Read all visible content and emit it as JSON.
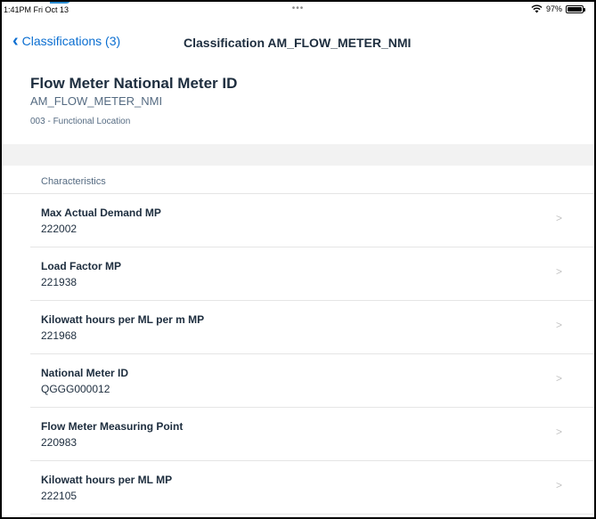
{
  "status_bar": {
    "time": "1:41PM  Fri Oct 13",
    "dots": "•••",
    "battery": "97%"
  },
  "nav": {
    "back_label": "Classifications (3)",
    "title": "Classification AM_FLOW_METER_NMI"
  },
  "header": {
    "title": "Flow Meter National Meter ID",
    "subtitle": "AM_FLOW_METER_NMI",
    "detail": "003 - Functional Location"
  },
  "characteristics": {
    "section_label": "Characteristics",
    "items": [
      {
        "label": "Max Actual Demand MP",
        "value": "222002"
      },
      {
        "label": "Load Factor MP",
        "value": "221938"
      },
      {
        "label": "Kilowatt hours per ML per m MP",
        "value": "221968"
      },
      {
        "label": "National Meter ID",
        "value": "QGGG000012"
      },
      {
        "label": "Flow Meter Measuring Point",
        "value": "220983"
      },
      {
        "label": "Kilowatt hours per ML MP",
        "value": "222105"
      }
    ]
  },
  "colors": {
    "accent": "#0a6ed1",
    "text": "#1d2d3e",
    "secondary": "#556b82"
  },
  "icons": {
    "back": "chevron-left-icon",
    "row": "chevron-right-icon",
    "wifi": "wifi-icon",
    "battery": "battery-icon"
  }
}
